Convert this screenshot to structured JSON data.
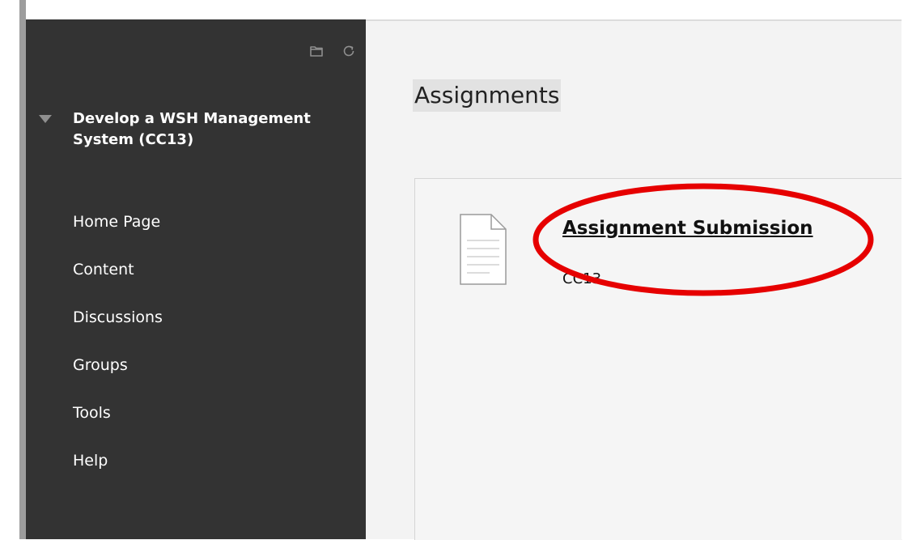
{
  "sidebar": {
    "course_title": "Develop a WSH Management System (CC13)",
    "items": [
      {
        "label": "Home Page"
      },
      {
        "label": "Content"
      },
      {
        "label": "Discussions"
      },
      {
        "label": "Groups"
      },
      {
        "label": "Tools"
      },
      {
        "label": "Help"
      }
    ]
  },
  "main": {
    "page_title": "Assignments",
    "item": {
      "title": "Assignment Submission",
      "subtitle": "CC13"
    }
  },
  "icons": {
    "folder": "folder-icon",
    "refresh": "refresh-icon",
    "collapse": "triangle-down-icon",
    "document": "document-icon"
  },
  "colors": {
    "sidebar_bg": "#333333",
    "main_bg": "#f3f3f3",
    "annotation": "#e60000"
  }
}
